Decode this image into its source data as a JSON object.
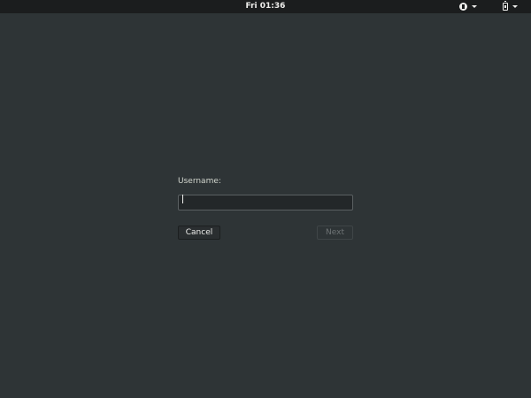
{
  "topbar": {
    "clock": "Fri 01:36",
    "accessibility_icon": "accessibility-icon",
    "power_icon": "battery-icon",
    "menu_caret_icon": "chevron-down-icon"
  },
  "login": {
    "username_label": "Username:",
    "username_value": "",
    "cancel_label": "Cancel",
    "next_label": "Next"
  },
  "colors": {
    "background": "#2e3436",
    "topbar": "#1b1d1e",
    "text": "#eeeeec",
    "disabled_text": "#6e7375"
  }
}
